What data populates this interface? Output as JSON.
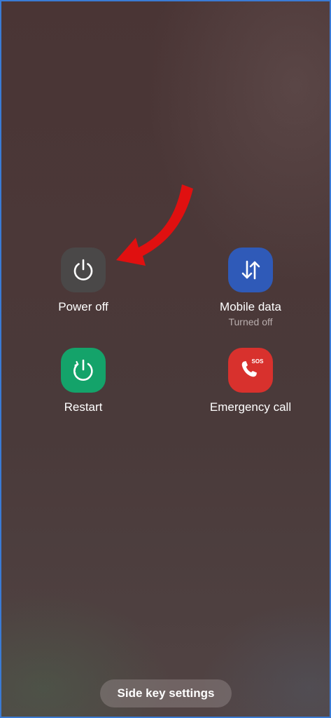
{
  "actions": {
    "power_off": {
      "label": "Power off",
      "color": "#4a4848",
      "icon": "power-icon"
    },
    "mobile_data": {
      "label": "Mobile data",
      "status": "Turned off",
      "color": "#2f5ab8",
      "icon": "data-arrows-icon"
    },
    "restart": {
      "label": "Restart",
      "color": "#14a36a",
      "icon": "restart-icon"
    },
    "emergency_call": {
      "label": "Emergency call",
      "color": "#d8312d",
      "icon": "sos-phone-icon",
      "icon_text": "SOS"
    }
  },
  "side_key": {
    "label": "Side key settings"
  },
  "annotation": {
    "color": "#e01010",
    "icon": "red-arrow-pointer"
  }
}
